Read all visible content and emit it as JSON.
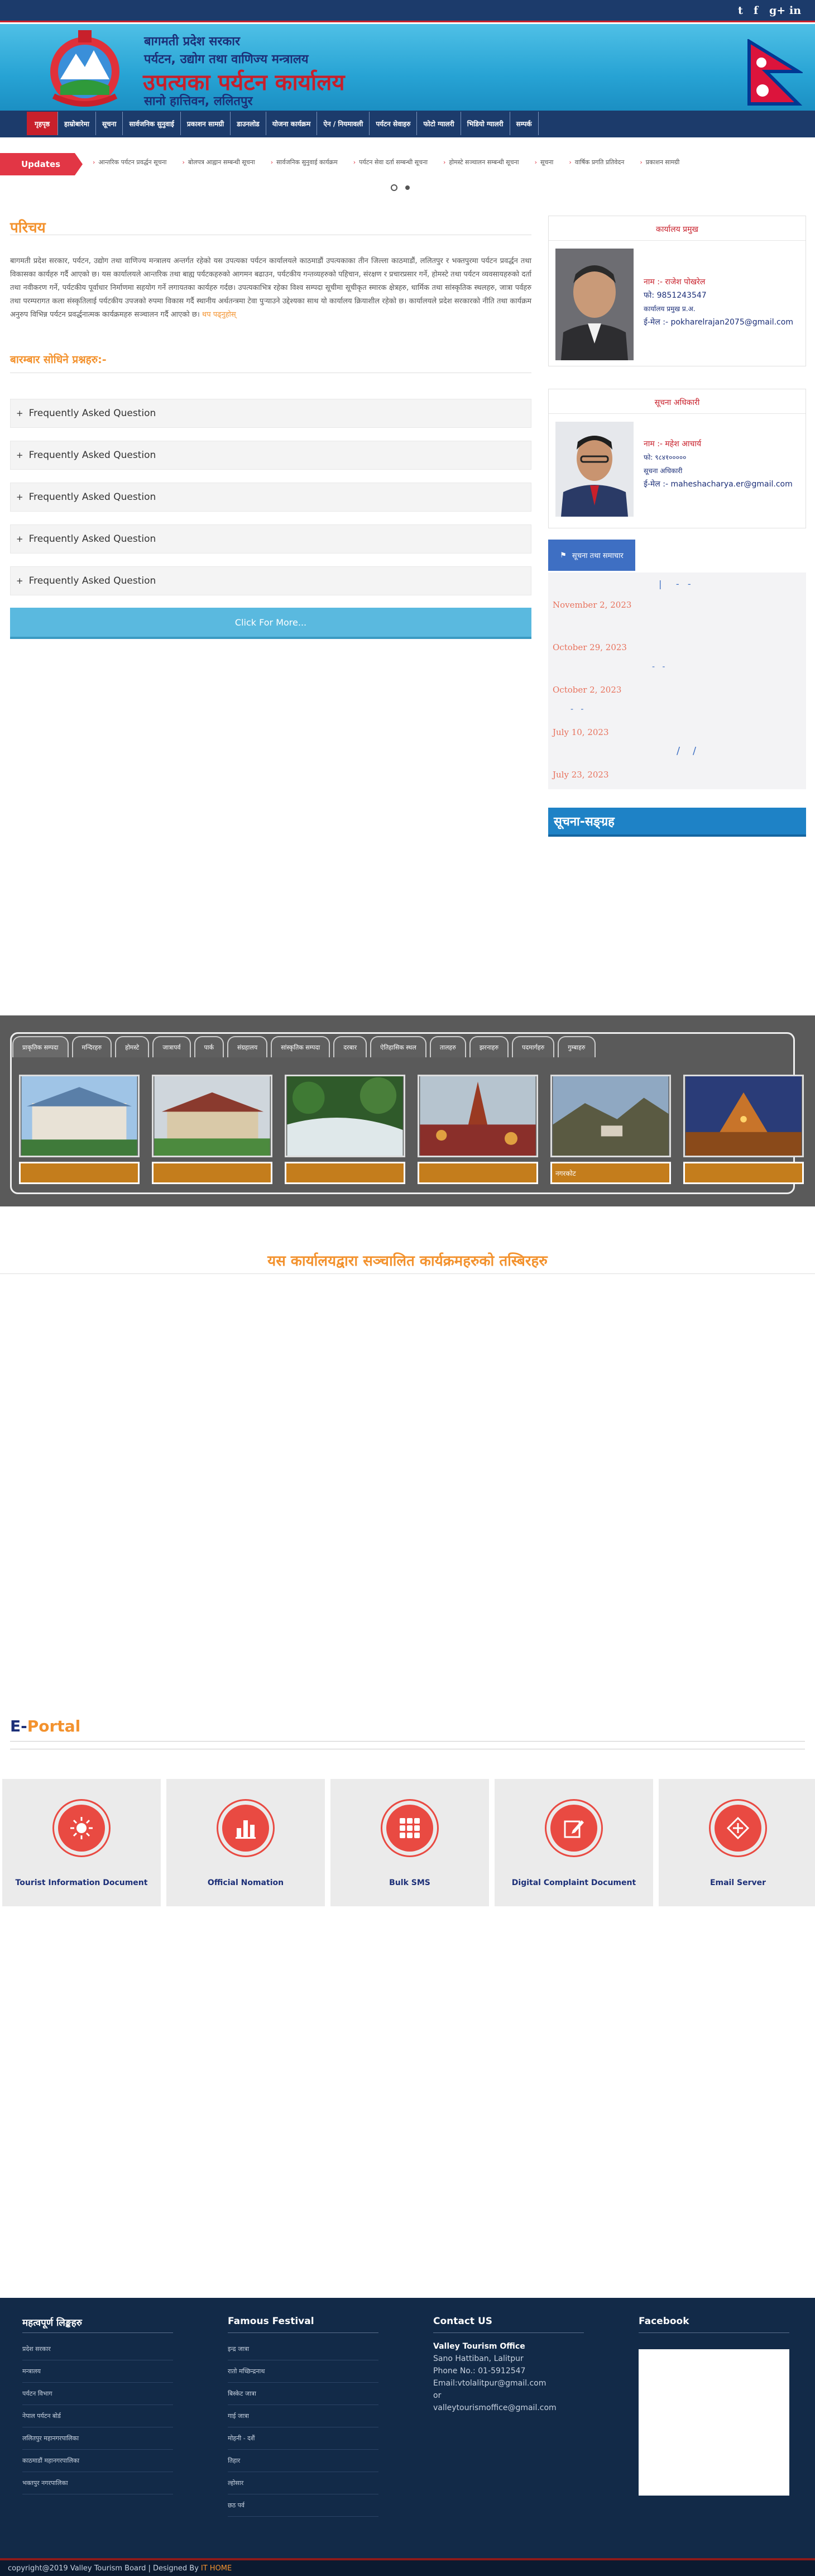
{
  "social": {
    "twitter": "t",
    "facebook": "f",
    "google": "g+",
    "linkedin": "in"
  },
  "header": {
    "line1": "बागमती प्रदेश सरकार",
    "line2": "पर्यटन, उद्योग तथा वाणिज्य मन्त्रालय",
    "line3": "उपत्यका पर्यटन कार्यालय",
    "line4": "सानो हात्तिवन, ललितपुर"
  },
  "nav": [
    "गृहपृष्ठ",
    "हाम्रोबारेमा",
    "सूचना",
    "सार्वजनिक सुनुवाई",
    "प्रकाशन सामग्री",
    "डाउनलोड",
    "योजना कार्यक्रम",
    "ऐन / नियमावली",
    "पर्यटन सेवाहरु",
    "फोटो ग्यालरी",
    "भिडियो ग्यालरी",
    "सम्पर्क"
  ],
  "updates": {
    "label": "Updates",
    "items": [
      "आन्तरिक पर्यटन प्रवर्द्धन सूचना",
      "बोलपत्र आह्वान सम्बन्धी सूचना",
      "सार्वजनिक सुनुवाई कार्यक्रम",
      "पर्यटन सेवा दर्ता सम्बन्धी सूचना",
      "होमस्टे सञ्चालन सम्बन्धी सूचना",
      "सूचना",
      "वार्षिक प्रगति प्रतिवेदन",
      "प्रकाशन सामग्री"
    ]
  },
  "intro": {
    "title": "परिचय",
    "text": "बागमती प्रदेश सरकार, पर्यटन, उद्योग तथा वाणिज्य मन्त्रालय अन्तर्गत रहेको यस उपत्यका पर्यटन कार्यालयले काठमाडौं उपत्यकाका तीन जिल्ला काठमाडौं, ललितपुर र भक्तपुरमा पर्यटन प्रवर्द्धन तथा विकासका कार्यहरु गर्दै आएको छ। यस कार्यालयले आन्तरिक तथा बाह्य पर्यटकहरुको आगमन बढाउन, पर्यटकीय गन्तव्यहरुको पहिचान, संरक्षण र प्रचारप्रसार गर्ने, होमस्टे तथा पर्यटन व्यवसायहरुको दर्ता तथा नवीकरण गर्ने, पर्यटकीय पूर्वाधार निर्माणमा सहयोग गर्ने लगायतका कार्यहरु गर्दछ। उपत्यकाभित्र रहेका विश्व सम्पदा सूचीमा सूचीकृत स्मारक क्षेत्रहरु, धार्मिक तथा सांस्कृतिक स्थलहरु, जात्रा पर्वहरु तथा परम्परागत कला संस्कृतिलाई पर्यटकीय उपजको रुपमा विकास गर्दै स्थानीय अर्थतन्त्रमा टेवा पुर्‍याउने उद्देश्यका साथ यो कार्यालय क्रियाशील रहेको छ। कार्यालयले प्रदेश सरकारको नीति तथा कार्यक्रम अनुरुप विभिन्न पर्यटन प्रवर्द्धनात्मक कार्यक्रमहरु सञ्चालन गर्दै आएको छ।",
    "more": "थप पढ्नुहोस्"
  },
  "faq": {
    "title": "बारम्बार सोधिने प्रश्नहरु:-",
    "items": [
      "Frequently Asked Question",
      "Frequently Asked Question",
      "Frequently Asked Question",
      "Frequently Asked Question",
      "Frequently Asked Question"
    ],
    "button": "Click For More..."
  },
  "chief": {
    "heading": "कार्यालय प्रमुख",
    "name": "नाम :- राजेश पोखरेल",
    "phone": "फो:  9851243547",
    "post": "कार्यालय प्रमुख प्र.अ.",
    "email": "ई-मेल :- pokharelrajan2075@gmail.com"
  },
  "info_officer": {
    "heading": "सूचना अधिकारी",
    "name": "नाम :- महेश आचार्य",
    "phone": "फो: ९८४१०००००",
    "post": "सूचना अधिकारी",
    "email": "ई-मेल :- maheshacharya.er@gmail.com"
  },
  "notices": {
    "button": "सूचना तथा समाचार",
    "dates": [
      "November 2, 2023",
      "October 29, 2023",
      "October 2, 2023",
      "July 10, 2023",
      "July 23, 2023"
    ],
    "archive": "सूचना-सङ्ग्रह"
  },
  "gallery": {
    "tabs": [
      "प्राकृतिक सम्पदा",
      "मन्दिरहरु",
      "होमस्टे",
      "जात्रापर्व",
      "पार्क",
      "संग्रहालय",
      "सांस्कृतिक सम्पदा",
      "दरबार",
      "ऐतिहासिक स्थल",
      "तालहरु",
      "झरनाहरु",
      "पदमार्गहरु",
      "गुम्बाहरु"
    ],
    "captions": [
      "",
      "",
      "",
      "",
      "नगरकोट",
      ""
    ]
  },
  "wide_title": "यस कार्यालयद्वारा सञ्चालित कार्यक्रमहरुको तस्बिरहरु",
  "eportal": {
    "title_a": "E-",
    "title_b": "Portal",
    "items": [
      {
        "label": "Tourist Information Document",
        "icon": "sun-icon"
      },
      {
        "label": "Official Nomation",
        "icon": "bar-chart-icon"
      },
      {
        "label": "Bulk SMS",
        "icon": "grid-icon"
      },
      {
        "label": "Digital Complaint Document",
        "icon": "edit-icon"
      },
      {
        "label": "Email Server",
        "icon": "email-server-icon"
      }
    ]
  },
  "footer": {
    "col1_title": "महत्वपूर्ण लिङ्कहरु",
    "col1": [
      "प्रदेश सरकार",
      "मन्त्रालय",
      "पर्यटन विभाग",
      "नेपाल पर्यटन बोर्ड",
      "ललितपुर महानगरपालिका",
      "काठमाडौं महानगरपालिका",
      "भक्तपुर नगरपालिका"
    ],
    "col2_title": "Famous Festival",
    "col2": [
      "इन्द्र जात्रा",
      "रातो मच्छिन्द्रनाथ",
      "बिस्केट जात्रा",
      "गाई जात्रा",
      "मोहनी - दशैं",
      "तिहार",
      "ल्होसार",
      "छठ पर्व"
    ],
    "col3_title": "Contact US",
    "contact_org": "Valley Tourism Office",
    "contact_lines": [
      "Sano Hattiban, Lalitpur",
      "Phone No.: 01-5912547",
      "Email:vtolalitpur@gmail.com",
      "or",
      "valleytourismoffice@gmail.com"
    ],
    "col4_title": "Facebook"
  },
  "copyright": {
    "text": "copyright@2019 Valley Tourism Board | Designed By",
    "link": "IT HOME"
  }
}
